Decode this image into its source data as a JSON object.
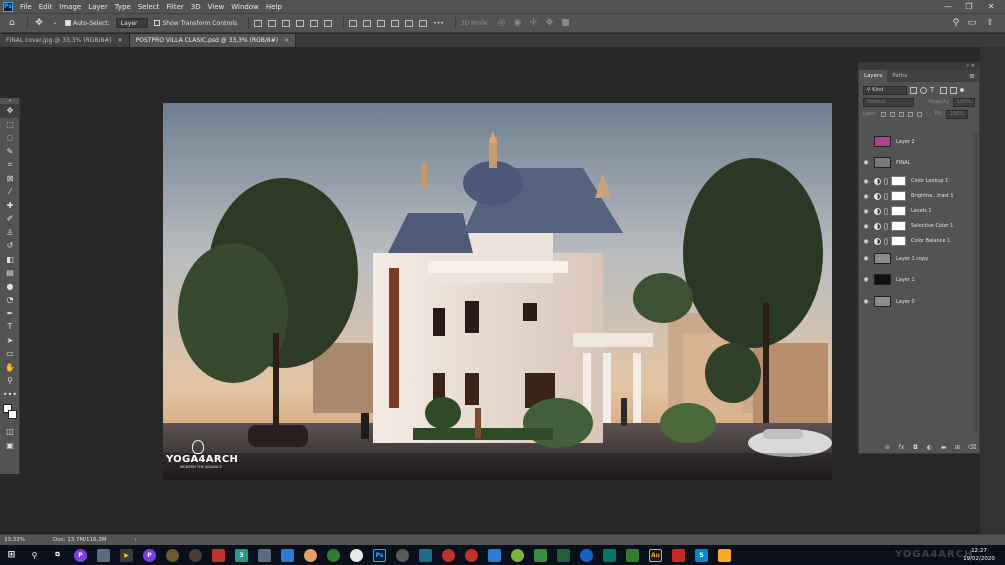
{
  "app": {
    "logo": "Ps"
  },
  "menu": [
    "File",
    "Edit",
    "Image",
    "Layer",
    "Type",
    "Select",
    "Filter",
    "3D",
    "View",
    "Window",
    "Help"
  ],
  "window_controls": {
    "minimize": "—",
    "maximize": "❐",
    "close": "✕"
  },
  "options_bar": {
    "auto_select_label": "Auto-Select:",
    "auto_select_checked": true,
    "target_value": "Layer",
    "transform_label": "Show Transform Controls",
    "transform_checked": false,
    "more": "•••",
    "mode_label": "3D Mode:"
  },
  "tabs": [
    {
      "label": "FINAL cover.jpg @ 33,3% (RGB/8#)",
      "close": "×",
      "active": false
    },
    {
      "label": "POSTPRO VILLA CLASIC.psd @ 33,3% (RGB/8#)",
      "close": "×",
      "active": true
    }
  ],
  "watermark": {
    "title": "YOGA4ARCH",
    "subtitle": "MODERN  THE ADVANCE"
  },
  "layers_panel": {
    "tabs": [
      "Layers",
      "Paths"
    ],
    "active_tab": "Layers",
    "filter_kind": "Kind",
    "blend_mode": "Normal",
    "opacity_label": "Opacity:",
    "opacity_value": "100%",
    "lock_label": "Lock:",
    "fill_label": "Fill:",
    "fill_value": "100%",
    "layers": [
      {
        "name": "Layer 2",
        "visible": false,
        "type": "pixel",
        "thumb": "#b0408c"
      },
      {
        "name": "FINAL",
        "visible": true,
        "type": "pixel",
        "thumb": "#7a7a7a"
      },
      {
        "name": "Color Lookup 1",
        "visible": true,
        "type": "adjustment"
      },
      {
        "name": "Brightne...trast 1",
        "visible": true,
        "type": "adjustment"
      },
      {
        "name": "Levels 1",
        "visible": true,
        "type": "adjustment"
      },
      {
        "name": "Selective Color 1",
        "visible": true,
        "type": "adjustment"
      },
      {
        "name": "Color Balance 1",
        "visible": true,
        "type": "adjustment"
      },
      {
        "name": "Layer 1 copy",
        "visible": true,
        "type": "pixel",
        "thumb": "#8a8a8a"
      },
      {
        "name": "Layer 1",
        "visible": true,
        "type": "pixel",
        "thumb": "#111111"
      },
      {
        "name": "Layer 0",
        "visible": true,
        "type": "pixel",
        "thumb": "#8d8d8d"
      }
    ]
  },
  "status": {
    "zoom": "33,33%",
    "doc": "Doc: 13,7M/116,3M",
    "arrow": "›"
  },
  "clock": {
    "time": "12:27",
    "date": "19/02/2020"
  },
  "taskbar_watermark": "YOGA4ARCH",
  "colors": {
    "ui_dark": "#535353",
    "canvas_bg": "#282828",
    "accent": "#31a8ff",
    "taskbar": "#0a0f1c"
  }
}
